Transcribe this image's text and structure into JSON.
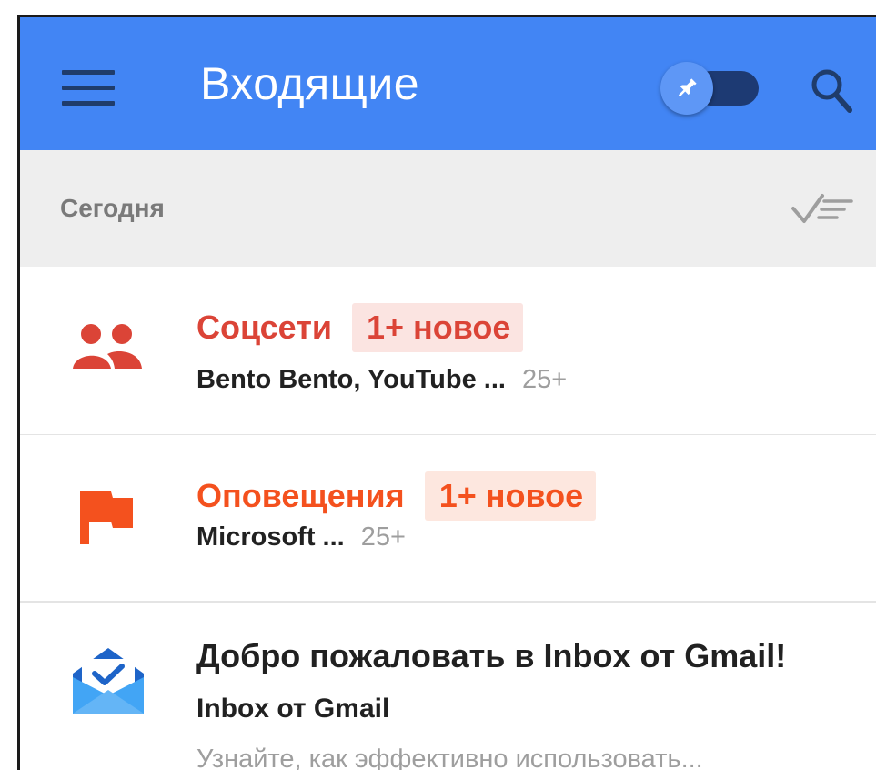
{
  "appbar": {
    "title": "Входящие",
    "color": "#4285f4",
    "icons": {
      "menu": "menu-icon",
      "pin": "pin-icon",
      "search": "search-icon"
    },
    "pin_toggle": {
      "label": "pin-toggle",
      "on": true
    }
  },
  "section": {
    "title": "Сегодня",
    "sweep_icon": "sweep-done-icon"
  },
  "bundles": [
    {
      "name": "Соцсети",
      "badge": "1+ новое",
      "senders": "Bento Bento, YouTube ...",
      "count": "25+",
      "icon": "social-people-icon",
      "color": "#db4437"
    },
    {
      "name": "Оповещения",
      "badge": "1+ новое",
      "senders": "Microsoft ...",
      "count": "25+",
      "icon": "updates-flag-icon",
      "color": "#f4511e"
    }
  ],
  "message": {
    "subject": "Добро пожаловать в Inbox от Gmail!",
    "sender": "Inbox от Gmail",
    "snippet": "Узнайте, как эффективно использовать...",
    "icon": "inbox-envelope-icon"
  }
}
